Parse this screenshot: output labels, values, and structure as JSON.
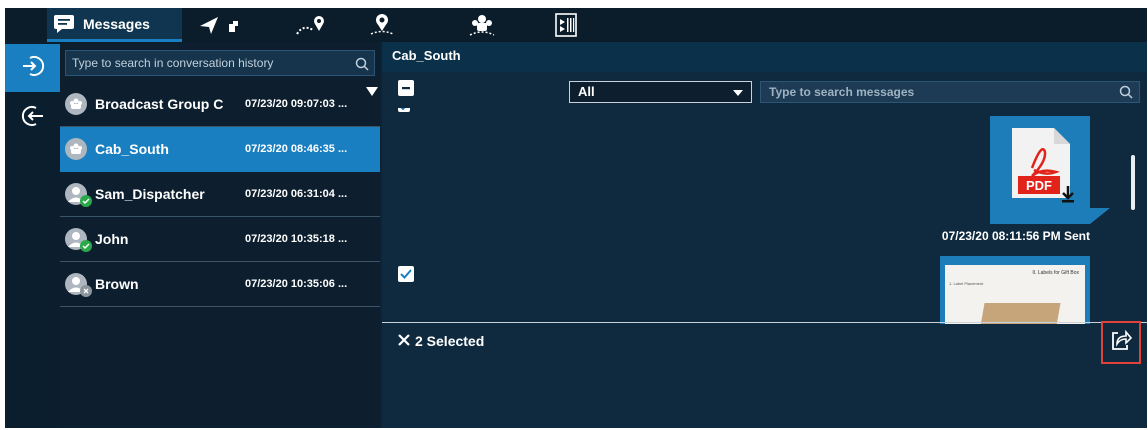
{
  "topbar": {
    "messages_tab_label": "Messages",
    "icons": [
      "chat-icon",
      "send-location-icon",
      "route-icon",
      "map-pin-icon",
      "group-location-icon",
      "video-icon"
    ]
  },
  "sidebar": {
    "items": [
      {
        "icon": "login-icon",
        "active": true
      },
      {
        "icon": "logout-icon",
        "active": false
      }
    ]
  },
  "conversations": {
    "search_placeholder": "Type to search in conversation history",
    "items": [
      {
        "name": "Broadcast Group C",
        "time": "07/23/20 09:07:03 ...",
        "type": "group",
        "selected": false
      },
      {
        "name": "Cab_South",
        "time": "07/23/20 08:46:35 ...",
        "type": "group",
        "selected": true
      },
      {
        "name": "Sam_Dispatcher",
        "time": "07/23/20 06:31:04 ...",
        "type": "user",
        "status": "online",
        "selected": false
      },
      {
        "name": "John",
        "time": "07/23/20 10:35:18 ...",
        "type": "user",
        "status": "online",
        "selected": false
      },
      {
        "name": "Brown",
        "time": "07/23/20 10:35:06 ...",
        "type": "user",
        "status": "offline",
        "selected": false
      }
    ]
  },
  "chat": {
    "title": "Cab_South",
    "filter_value": "All",
    "search_placeholder": "Type to search messages",
    "messages": [
      {
        "kind": "pdf",
        "badge": "PDF",
        "meta": "07/23/20 08:11:56 PM Sent",
        "checked": true
      },
      {
        "kind": "image",
        "thumb_title": "II. Labels for Gift Box",
        "thumb_sub": "1. Label Placement",
        "checked": true
      }
    ],
    "selection_label": "2 Selected"
  },
  "colors": {
    "accent": "#1a7fc0",
    "background": "#0f2233",
    "highlight": "#e0413a",
    "status_online": "#2aa84a"
  }
}
